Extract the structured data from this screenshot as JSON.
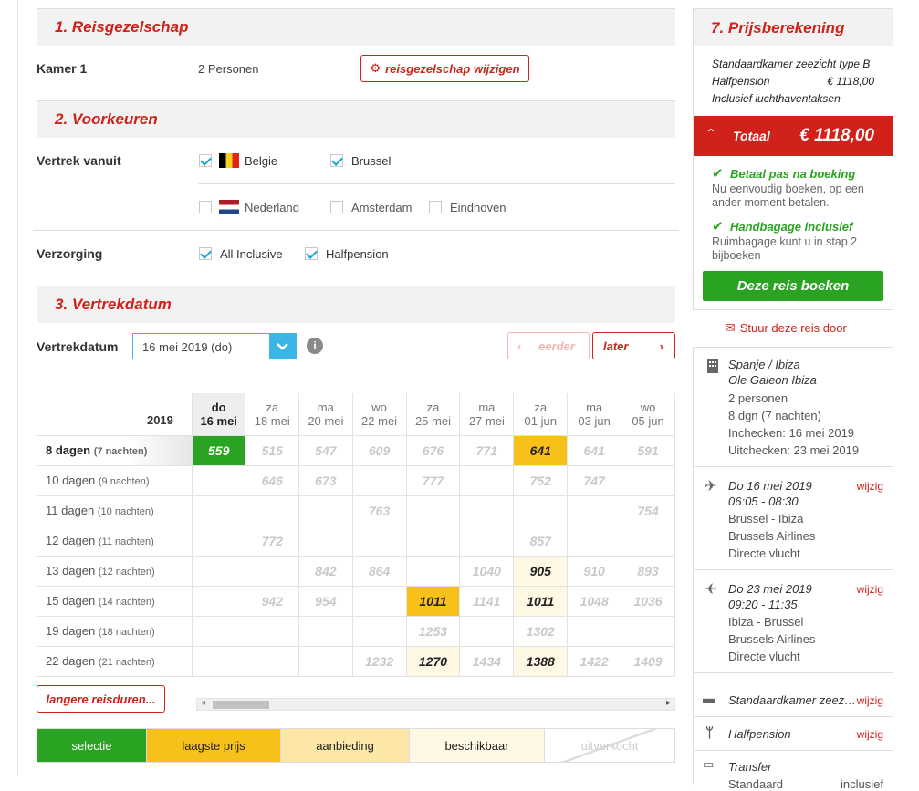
{
  "sections": {
    "s1": "1.  Reisgezelschap",
    "s2": "2.  Voorkeuren",
    "s3": "3.  Vertrekdatum",
    "s7": "7.  Prijsberekening"
  },
  "kamer": {
    "label": "Kamer 1",
    "value": "2 Personen",
    "change_btn": "reisgezelschap wijzigen"
  },
  "vertrek": {
    "label": "Vertrek vanuit",
    "options": [
      {
        "name": "Belgie",
        "checked": true
      },
      {
        "name": "Brussel",
        "checked": true
      },
      {
        "name": "Nederland",
        "checked": false
      },
      {
        "name": "Amsterdam",
        "checked": false
      },
      {
        "name": "Eindhoven",
        "checked": false
      }
    ]
  },
  "verzorging": {
    "label": "Verzorging",
    "options": [
      {
        "name": "All Inclusive",
        "checked": true
      },
      {
        "name": "Halfpension",
        "checked": true
      }
    ]
  },
  "vertrekdatum": {
    "label": "Vertrekdatum",
    "selected": "16 mei 2019 (do)",
    "eerder": "eerder",
    "later": "later"
  },
  "calendar": {
    "year": "2019",
    "columns": [
      {
        "day": "do",
        "date": "16 mei"
      },
      {
        "day": "za",
        "date": "18 mei"
      },
      {
        "day": "ma",
        "date": "20 mei"
      },
      {
        "day": "wo",
        "date": "22 mei"
      },
      {
        "day": "za",
        "date": "25 mei"
      },
      {
        "day": "ma",
        "date": "27 mei"
      },
      {
        "day": "za",
        "date": "01 jun"
      },
      {
        "day": "ma",
        "date": "03 jun"
      },
      {
        "day": "wo",
        "date": "05 jun"
      }
    ],
    "rows": [
      {
        "label": "8 dagen",
        "nights": "(7 nachten)",
        "cells": [
          "559",
          "515",
          "547",
          "609",
          "676",
          "771",
          "641",
          "641",
          "591"
        ]
      },
      {
        "label": "10 dagen",
        "nights": "(9 nachten)",
        "cells": [
          "",
          "646",
          "673",
          "",
          "777",
          "",
          "752",
          "747",
          ""
        ]
      },
      {
        "label": "11 dagen",
        "nights": "(10 nachten)",
        "cells": [
          "",
          "",
          "",
          "763",
          "",
          "",
          "",
          "",
          "754"
        ]
      },
      {
        "label": "12 dagen",
        "nights": "(11 nachten)",
        "cells": [
          "",
          "772",
          "",
          "",
          "",
          "",
          "857",
          "",
          ""
        ]
      },
      {
        "label": "13 dagen",
        "nights": "(12 nachten)",
        "cells": [
          "",
          "",
          "842",
          "864",
          "",
          "1040",
          "905",
          "910",
          "893"
        ]
      },
      {
        "label": "15 dagen",
        "nights": "(14 nachten)",
        "cells": [
          "",
          "942",
          "954",
          "",
          "1011",
          "1141",
          "1011",
          "1048",
          "1036"
        ]
      },
      {
        "label": "19 dagen",
        "nights": "(18 nachten)",
        "cells": [
          "",
          "",
          "",
          "",
          "1253",
          "",
          "1302",
          "",
          ""
        ]
      },
      {
        "label": "22 dagen",
        "nights": "(21 nachten)",
        "cells": [
          "",
          "",
          "",
          "1232",
          "1270",
          "1434",
          "1388",
          "1422",
          "1409"
        ]
      }
    ],
    "langere": "langere reisduren..."
  },
  "legend": [
    "selectie",
    "laagste prijs",
    "aanbieding",
    "beschikbaar",
    "uitverkocht"
  ],
  "colors": {
    "red": "#d0211a",
    "green": "#29a321",
    "yellow": "#f7c11a",
    "cream": "#fef8e4"
  },
  "prijs": {
    "line1": "Standaardkamer zeezicht type B",
    "line2": "Halfpension",
    "line2_price": "€ 1118,00",
    "line3": "Inclusief luchthaventaksen",
    "totaal_label": "Totaal",
    "totaal_value": "€ 1118,00",
    "betaal_title": "Betaal pas na boeking",
    "betaal_text": "Nu eenvoudig boeken, op een ander moment betalen.",
    "handbagage_title": "Handbagage inclusief",
    "handbagage_text": "Ruimbagage kunt u in stap 2 bijboeken",
    "boek_btn": "Deze reis boeken",
    "stuur": "Stuur deze reis door"
  },
  "hotel": {
    "region": "Spanje / Ibiza",
    "name": "Ole Galeon Ibiza",
    "personen": "2 personen",
    "duur": "8 dgn (7 nachten)",
    "inchecken": "Inchecken: 16 mei 2019",
    "uitchecken": "Uitchecken: 23 mei 2019"
  },
  "flights": [
    {
      "date": "Do 16 mei 2019",
      "time": "06:05 - 08:30",
      "route": "Brussel - Ibiza",
      "airline": "Brussels Airlines",
      "type": "Directe vlucht",
      "wijzig": "wijzig"
    },
    {
      "date": "Do 23 mei 2019",
      "time": "09:20 - 11:35",
      "route": "Ibiza - Brussel",
      "airline": "Brussels Airlines",
      "type": "Directe vlucht",
      "wijzig": "wijzig"
    }
  ],
  "extras": [
    {
      "name": "Standaardkamer zeez…",
      "action": "wijzig"
    },
    {
      "name": "Halfpension",
      "action": "wijzig"
    },
    {
      "name": "Transfer",
      "action": ""
    },
    {
      "name": "Standaard",
      "action": "inclusief"
    }
  ]
}
